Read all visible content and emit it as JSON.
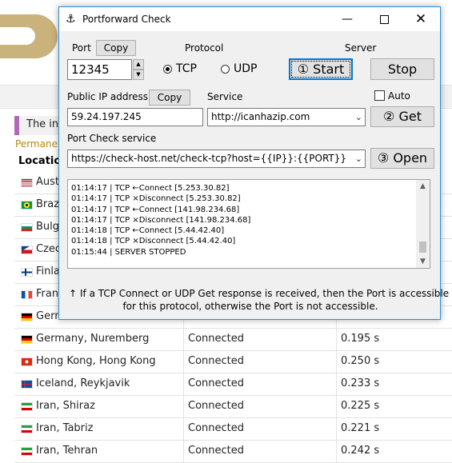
{
  "background": {
    "info_text": "The in",
    "permanent_text": "Permane",
    "location_header": "Locatio",
    "rows": [
      {
        "flag": "us",
        "city": "Aust",
        "status": "",
        "time": ""
      },
      {
        "flag": "br",
        "city": "Braz",
        "status": "",
        "time": ""
      },
      {
        "flag": "bg",
        "city": "Bulga",
        "status": "",
        "time": ""
      },
      {
        "flag": "cz",
        "city": "Czec",
        "status": "",
        "time": ""
      },
      {
        "flag": "fi",
        "city": "Finla",
        "status": "",
        "time": ""
      },
      {
        "flag": "fr",
        "city": "Fran",
        "status": "",
        "time": ""
      },
      {
        "flag": "de",
        "city": "Germ",
        "status": "",
        "time": ""
      },
      {
        "flag": "de",
        "city": "Germany, Nuremberg",
        "status": "Connected",
        "time": "0.195 s"
      },
      {
        "flag": "hk",
        "city": "Hong Kong, Hong Kong",
        "status": "Connected",
        "time": "0.250 s"
      },
      {
        "flag": "is",
        "city": "Iceland, Reykjavik",
        "status": "Connected",
        "time": "0.233 s"
      },
      {
        "flag": "ir",
        "city": "Iran, Shiraz",
        "status": "Connected",
        "time": "0.225 s"
      },
      {
        "flag": "ir",
        "city": "Iran, Tabriz",
        "status": "Connected",
        "time": "0.221 s"
      },
      {
        "flag": "ir",
        "city": "Iran, Tehran",
        "status": "Connected",
        "time": "0.242 s"
      }
    ]
  },
  "window": {
    "title": "Portforward Check",
    "minimize": "—",
    "close": "✕"
  },
  "port": {
    "label": "Port",
    "copy_label": "Copy",
    "value": "12345"
  },
  "protocol": {
    "label": "Protocol",
    "tcp": "TCP",
    "udp": "UDP",
    "selected": "TCP"
  },
  "server": {
    "label": "Server",
    "start_label": "① Start",
    "stop_label": "Stop"
  },
  "public_ip": {
    "label": "Public IP address",
    "copy_label": "Copy",
    "value": "59.24.197.245"
  },
  "service": {
    "label": "Service",
    "value": "http://icanhazip.com"
  },
  "auto": {
    "label": "Auto",
    "checked": false
  },
  "get_label": "② Get",
  "check_service": {
    "label": "Port Check service",
    "value": "https://check-host.net/check-tcp?host={{IP}}:{{PORT}}"
  },
  "open_label": "③ Open",
  "log": [
    "01:14:17 | TCP ←Connect [5.253.30.82]",
    "01:14:17 | TCP ×Disconnect [5.253.30.82]",
    "01:14:17 | TCP ←Connect [141.98.234.68]",
    "01:14:17 | TCP ×Disconnect [141.98.234.68]",
    "01:14:18 | TCP ←Connect [5.44.42.40]",
    "01:14:18 | TCP ×Disconnect [5.44.42.40]",
    "01:15:44 | SERVER STOPPED"
  ],
  "info": {
    "line1": "If a TCP Connect or UDP Get response is received, then the Port is accessible",
    "line2": "for this protocol, otherwise the Port is not accessible."
  },
  "colors": {
    "accent": "#0078d7",
    "logo": "#c9b27c",
    "info_bar": "#b067b8",
    "link": "#b8860b"
  }
}
